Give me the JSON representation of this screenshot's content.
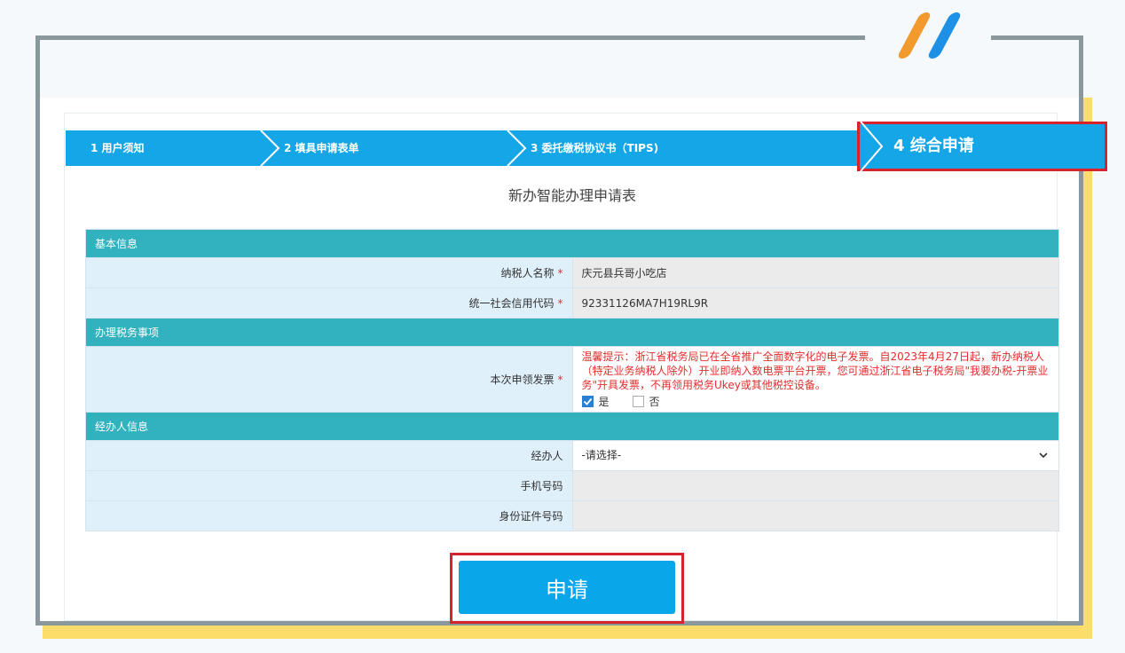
{
  "steps": [
    {
      "label": "1 用户须知"
    },
    {
      "label": "2 填具申请表单"
    },
    {
      "label": "3 委托缴税协议书（TIPS)"
    },
    {
      "label": "4 综合申请"
    }
  ],
  "form": {
    "title": "新办智能办理申请表",
    "section_basic": "基本信息",
    "taxpayer_name_label": "纳税人名称",
    "taxpayer_name_value": "庆元县兵哥小吃店",
    "credit_code_label": "统一社会信用代码",
    "credit_code_value": "92331126MA7H19RL9R",
    "section_tax": "办理税务事项",
    "invoice_label": "本次申领发票",
    "notice": "温馨提示：浙江省税务局已在全省推广全面数字化的电子发票。自2023年4月27日起，新办纳税人（特定业务纳税人除外）开业即纳入数电票平台开票，您可通过浙江省电子税务局\"我要办税-开票业务\"开具发票，不再领用税务Ukey或其他税控设备。",
    "option_yes": "是",
    "option_no": "否",
    "section_agent": "经办人信息",
    "agent_label": "经办人",
    "agent_select": "-请选择-",
    "phone_label": "手机号码",
    "id_label": "身份证件号码",
    "required_mark": "*"
  },
  "apply_button": "申请",
  "colors": {
    "step_bar": "#14a6e6",
    "section_header": "#31b2be",
    "highlight": "#d7232b",
    "apply": "#0aa6ea"
  }
}
